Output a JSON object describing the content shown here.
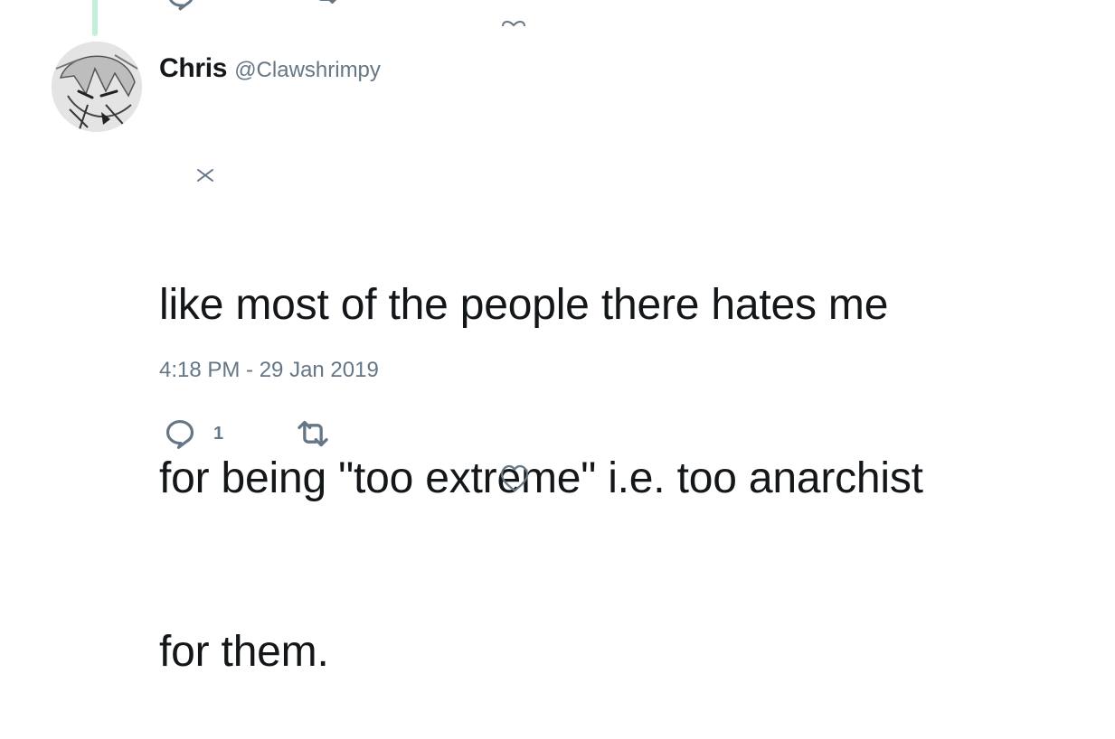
{
  "tweet": {
    "display_name": "Chris",
    "handle": "@Clawshrimpy",
    "text_lines": [
      "like most of the people there hates me",
      "for being \"too extreme\" i.e. too anarchist",
      "for them."
    ],
    "timestamp": "4:18 PM - 29 Jan 2019",
    "reply_count": "1"
  },
  "icons": {
    "reply": "reply-icon",
    "retweet": "retweet-icon",
    "like": "heart-icon",
    "avatar": "avatar-image",
    "dismiss": "close-icon"
  },
  "colors": {
    "text": "#14171a",
    "secondary": "#657786",
    "thread_line": "#c4eed8",
    "background": "#ffffff"
  }
}
